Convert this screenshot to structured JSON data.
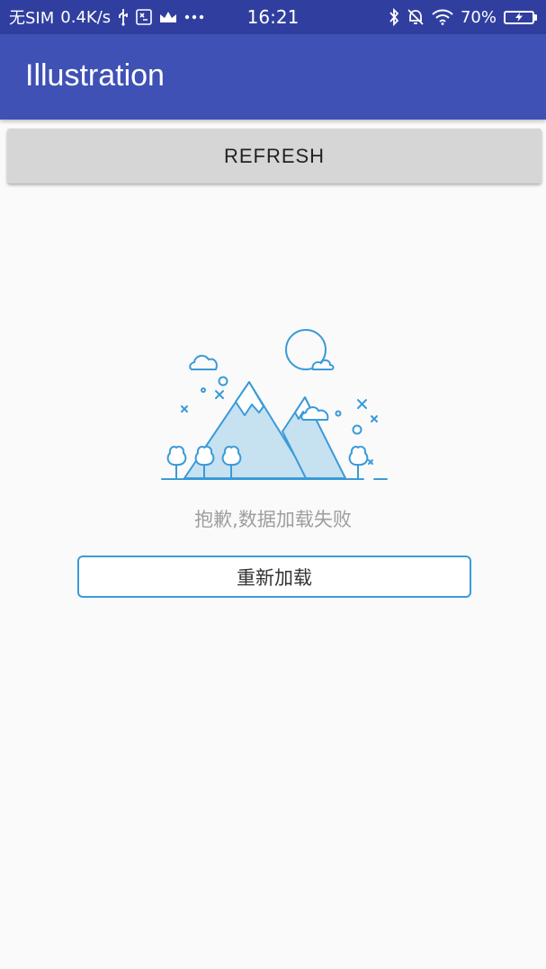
{
  "status_bar": {
    "carrier": "无SIM",
    "speed": "0.4K/s",
    "time": "16:21",
    "battery": "70%",
    "icons": [
      "usb-icon",
      "debug-icon",
      "crown-icon",
      "more-icon",
      "bluetooth-icon",
      "alarm-off-icon",
      "wifi-icon",
      "battery-charging-icon"
    ]
  },
  "app_bar": {
    "title": "Illustration"
  },
  "toolbar": {
    "refresh_label": "REFRESH"
  },
  "error_state": {
    "illustration": "mountain-landscape-illustration",
    "message": "抱歉,数据加载失败",
    "reload_label": "重新加载"
  },
  "colors": {
    "status_bar": "#303F9F",
    "app_bar": "#3F51B5",
    "accent_line": "#3a9ad9",
    "mountain_fill": "#c6e1f0",
    "background": "#fafafa"
  }
}
